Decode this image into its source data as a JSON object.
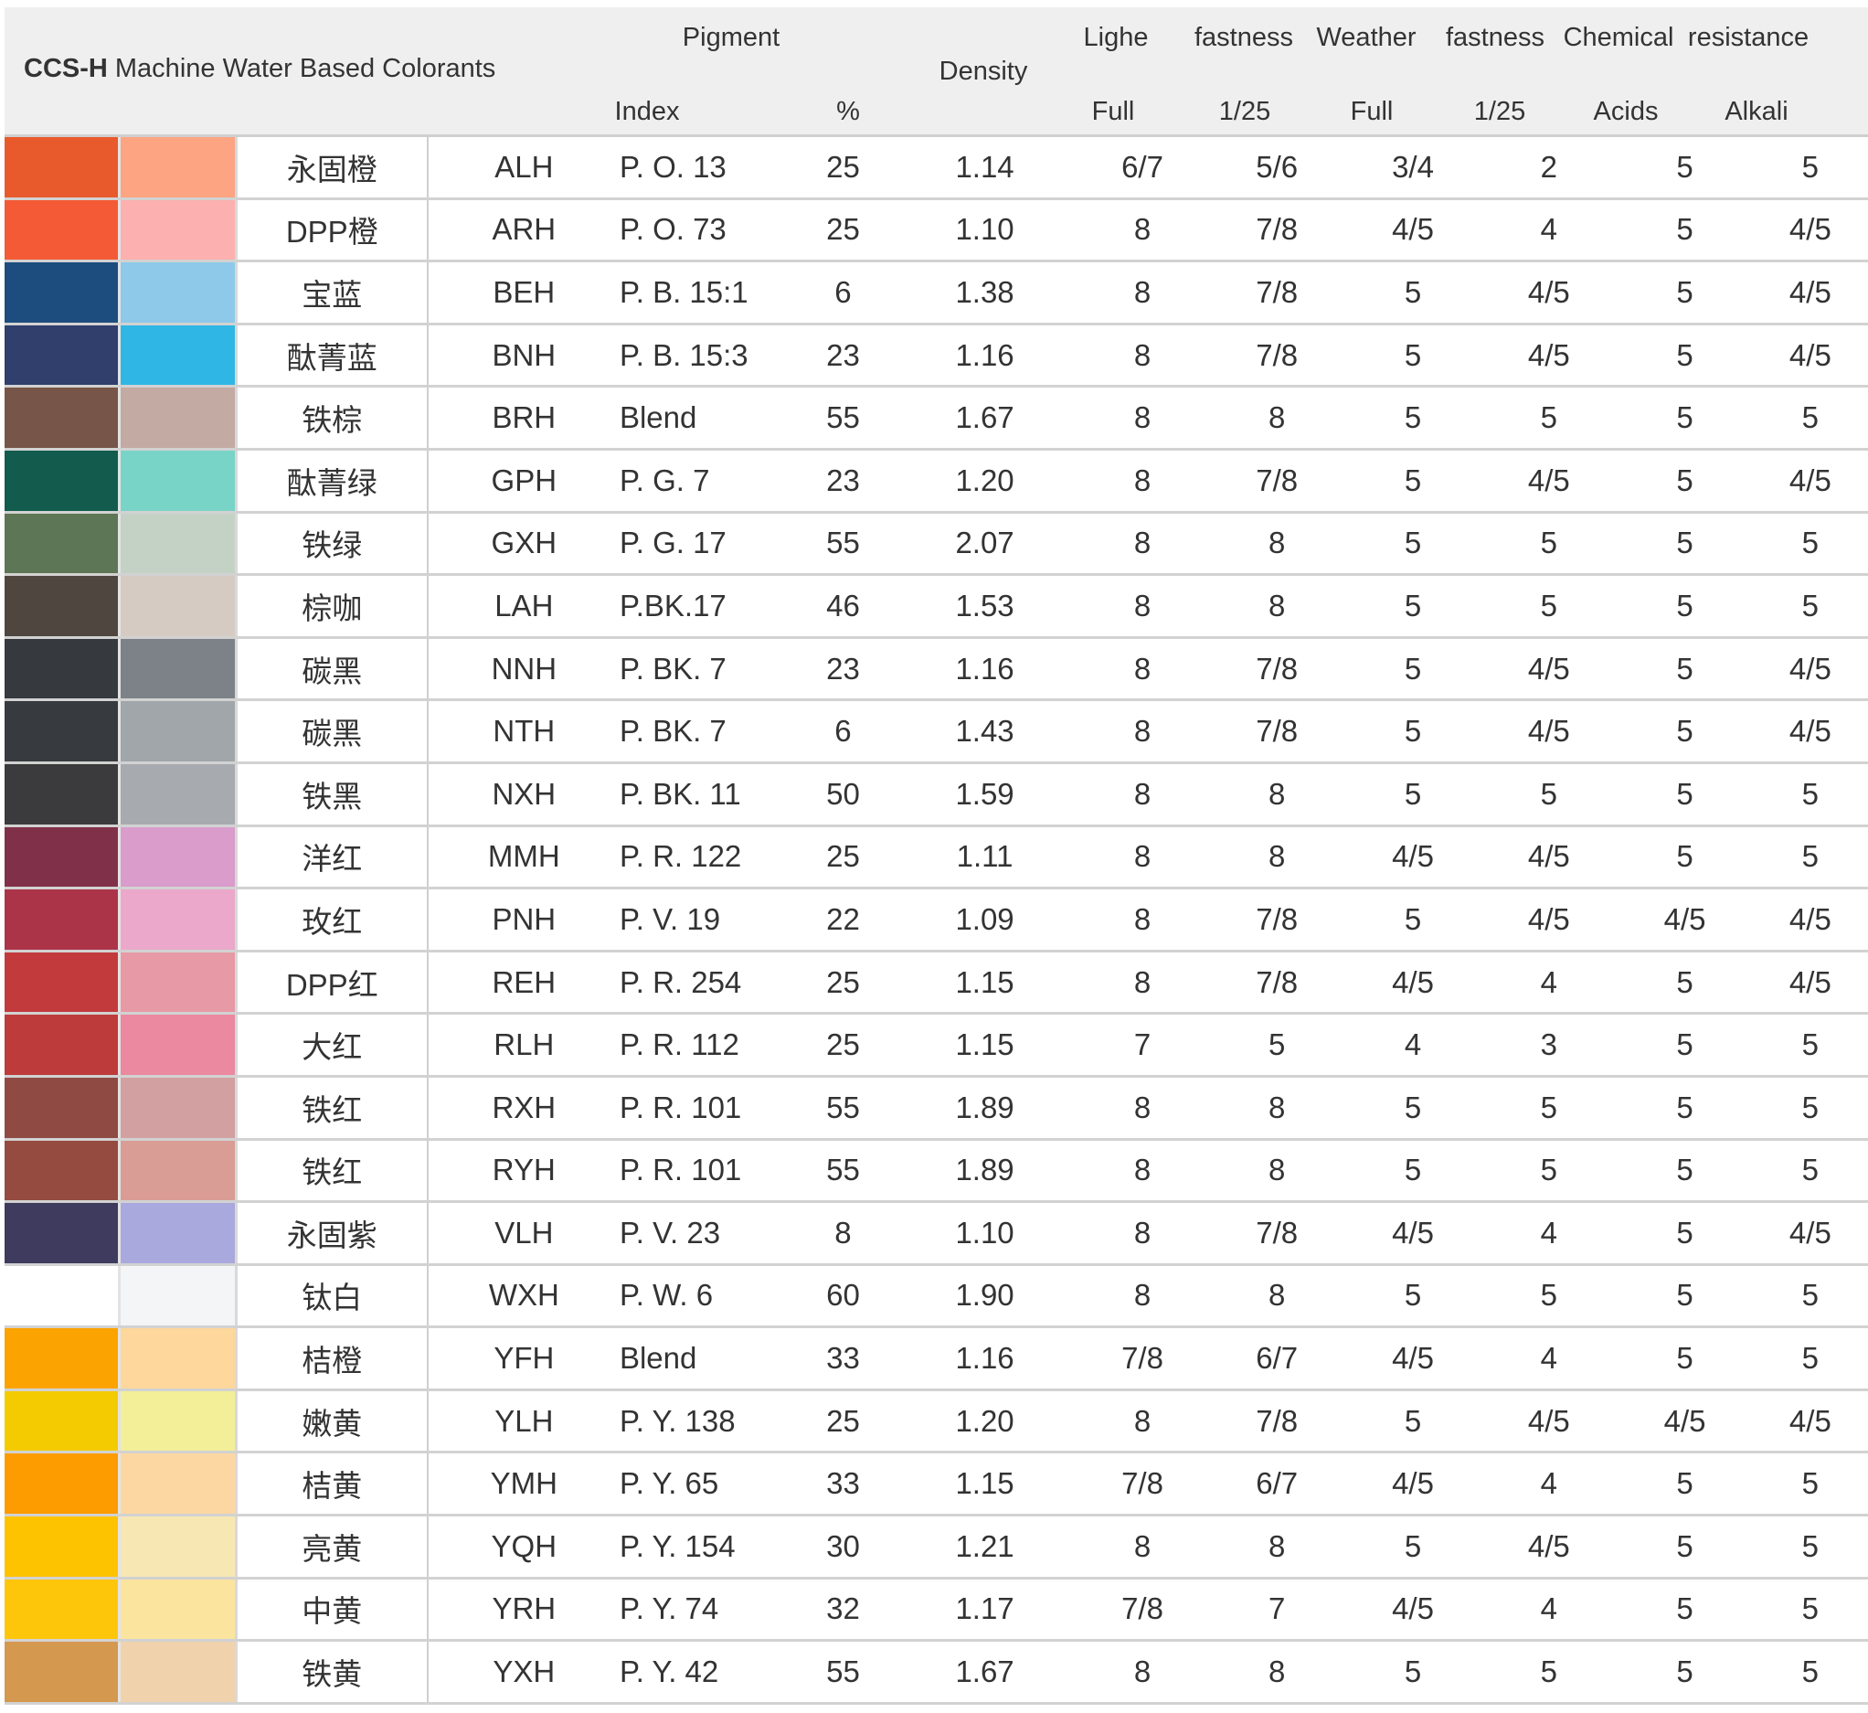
{
  "header": {
    "title_bold": "CCS-H",
    "title_rest": " Machine Water Based Colorants",
    "pigment": "Pigment",
    "index": "Index",
    "percent": "%",
    "density": "Density",
    "lighe": "Lighe",
    "fastness1": "fastness",
    "weather": "Weather",
    "fastness2": "fastness",
    "chemical": "Chemical",
    "resistance": "resistance",
    "full1": "Full",
    "ratio1": "1/25",
    "full2": "Full",
    "ratio2": "1/25",
    "acids": "Acids",
    "alkali": "Alkali"
  },
  "rows": [
    {
      "c1": "#e85a2c",
      "c2": "#fda482",
      "cn": "永固橙",
      "code": "ALH",
      "index": "P. O. 13",
      "pct": "25",
      "density": "1.14",
      "lf": "6/7",
      "lr": "5/6",
      "wf": "3/4",
      "wr": "2",
      "acid": "5",
      "alk": "5"
    },
    {
      "c1": "#f35a35",
      "c2": "#fdb0b0",
      "cn": "DPP橙",
      "code": "ARH",
      "index": "P. O. 73",
      "pct": "25",
      "density": "1.10",
      "lf": "8",
      "lr": "7/8",
      "wf": "4/5",
      "wr": "4",
      "acid": "5",
      "alk": "4/5"
    },
    {
      "c1": "#1c4d7e",
      "c2": "#8ec9e9",
      "cn": "宝蓝",
      "code": "BEH",
      "index": "P. B. 15:1",
      "pct": "6",
      "density": "1.38",
      "lf": "8",
      "lr": "7/8",
      "wf": "5",
      "wr": "4/5",
      "acid": "5",
      "alk": "4/5"
    },
    {
      "c1": "#303f6c",
      "c2": "#2fb6e4",
      "cn": "酞菁蓝",
      "code": "BNH",
      "index": "P. B. 15:3",
      "pct": "23",
      "density": "1.16",
      "lf": "8",
      "lr": "7/8",
      "wf": "5",
      "wr": "4/5",
      "acid": "5",
      "alk": "4/5"
    },
    {
      "c1": "#775549",
      "c2": "#c3aaa3",
      "cn": "铁棕",
      "code": "BRH",
      "index": "Blend",
      "pct": "55",
      "density": "1.67",
      "lf": "8",
      "lr": "8",
      "wf": "5",
      "wr": "5",
      "acid": "5",
      "alk": "5"
    },
    {
      "c1": "#135b4d",
      "c2": "#78d4c6",
      "cn": "酞菁绿",
      "code": "GPH",
      "index": "P. G. 7",
      "pct": "23",
      "density": "1.20",
      "lf": "8",
      "lr": "7/8",
      "wf": "5",
      "wr": "4/5",
      "acid": "5",
      "alk": "4/5"
    },
    {
      "c1": "#5d7655",
      "c2": "#c4d2c5",
      "cn": "铁绿",
      "code": "GXH",
      "index": "P. G. 17",
      "pct": "55",
      "density": "2.07",
      "lf": "8",
      "lr": "8",
      "wf": "5",
      "wr": "5",
      "acid": "5",
      "alk": "5"
    },
    {
      "c1": "#4f4640",
      "c2": "#d5cbc3",
      "cn": "棕咖",
      "code": "LAH",
      "index": "P.BK.17",
      "pct": "46",
      "density": "1.53",
      "lf": "8",
      "lr": "8",
      "wf": "5",
      "wr": "5",
      "acid": "5",
      "alk": "5"
    },
    {
      "c1": "#363a3f",
      "c2": "#7d8288",
      "cn": "碳黑",
      "code": "NNH",
      "index": "P. BK. 7",
      "pct": "23",
      "density": "1.16",
      "lf": "8",
      "lr": "7/8",
      "wf": "5",
      "wr": "4/5",
      "acid": "5",
      "alk": "4/5"
    },
    {
      "c1": "#373a3e",
      "c2": "#a1a6ab",
      "cn": "碳黑",
      "code": "NTH",
      "index": "P. BK. 7",
      "pct": "6",
      "density": "1.43",
      "lf": "8",
      "lr": "7/8",
      "wf": "5",
      "wr": "4/5",
      "acid": "5",
      "alk": "4/5"
    },
    {
      "c1": "#3b3a3d",
      "c2": "#a7abb0",
      "cn": "铁黑",
      "code": "NXH",
      "index": "P. BK. 11",
      "pct": "50",
      "density": "1.59",
      "lf": "8",
      "lr": "8",
      "wf": "5",
      "wr": "5",
      "acid": "5",
      "alk": "5"
    },
    {
      "c1": "#81304a",
      "c2": "#d99ccb",
      "cn": "洋红",
      "code": "MMH",
      "index": "P. R. 122",
      "pct": "25",
      "density": "1.11",
      "lf": "8",
      "lr": "8",
      "wf": "4/5",
      "wr": "4/5",
      "acid": "5",
      "alk": "5"
    },
    {
      "c1": "#ac3449",
      "c2": "#eba8cb",
      "cn": "玫红",
      "code": "PNH",
      "index": "P. V. 19",
      "pct": "22",
      "density": "1.09",
      "lf": "8",
      "lr": "7/8",
      "wf": "5",
      "wr": "4/5",
      "acid": "4/5",
      "alk": "4/5"
    },
    {
      "c1": "#c33a3c",
      "c2": "#e899a6",
      "cn": "DPP红",
      "code": "REH",
      "index": "P. R. 254",
      "pct": "25",
      "density": "1.15",
      "lf": "8",
      "lr": "7/8",
      "wf": "4/5",
      "wr": "4",
      "acid": "5",
      "alk": "4/5"
    },
    {
      "c1": "#bd3b3a",
      "c2": "#ea89a0",
      "cn": "大红",
      "code": "RLH",
      "index": "P. R. 112",
      "pct": "25",
      "density": "1.15",
      "lf": "7",
      "lr": "5",
      "wf": "4",
      "wr": "3",
      "acid": "5",
      "alk": "5"
    },
    {
      "c1": "#8f4a44",
      "c2": "#d2a0a0",
      "cn": "铁红",
      "code": "RXH",
      "index": "P. R. 101",
      "pct": "55",
      "density": "1.89",
      "lf": "8",
      "lr": "8",
      "wf": "5",
      "wr": "5",
      "acid": "5",
      "alk": "5"
    },
    {
      "c1": "#964b41",
      "c2": "#d99d96",
      "cn": "铁红",
      "code": "RYH",
      "index": "P. R. 101",
      "pct": "55",
      "density": "1.89",
      "lf": "8",
      "lr": "8",
      "wf": "5",
      "wr": "5",
      "acid": "5",
      "alk": "5"
    },
    {
      "c1": "#3e3b5e",
      "c2": "#aaa9de",
      "cn": "永固紫",
      "code": "VLH",
      "index": "P. V. 23",
      "pct": "8",
      "density": "1.10",
      "lf": "8",
      "lr": "7/8",
      "wf": "4/5",
      "wr": "4",
      "acid": "5",
      "alk": "4/5"
    },
    {
      "c1": "#ffffff",
      "c2": "#f4f5f7",
      "cn": "钛白",
      "code": "WXH",
      "index": "P. W. 6",
      "pct": "60",
      "density": "1.90",
      "lf": "8",
      "lr": "8",
      "wf": "5",
      "wr": "5",
      "acid": "5",
      "alk": "5"
    },
    {
      "c1": "#fba300",
      "c2": "#fdd79b",
      "cn": "桔橙",
      "code": "YFH",
      "index": "Blend",
      "pct": "33",
      "density": "1.16",
      "lf": "7/8",
      "lr": "6/7",
      "wf": "4/5",
      "wr": "4",
      "acid": "5",
      "alk": "5"
    },
    {
      "c1": "#f3cb00",
      "c2": "#f3ef98",
      "cn": "嫩黄",
      "code": "YLH",
      "index": "P. Y. 138",
      "pct": "25",
      "density": "1.20",
      "lf": "8",
      "lr": "7/8",
      "wf": "5",
      "wr": "4/5",
      "acid": "4/5",
      "alk": "4/5"
    },
    {
      "c1": "#fc9c00",
      "c2": "#fdd7a2",
      "cn": "桔黄",
      "code": "YMH",
      "index": "P. Y. 65",
      "pct": "33",
      "density": "1.15",
      "lf": "7/8",
      "lr": "6/7",
      "wf": "4/5",
      "wr": "4",
      "acid": "5",
      "alk": "5"
    },
    {
      "c1": "#fdc300",
      "c2": "#f7e8b3",
      "cn": "亮黄",
      "code": "YQH",
      "index": "P. Y. 154",
      "pct": "30",
      "density": "1.21",
      "lf": "8",
      "lr": "8",
      "wf": "5",
      "wr": "4/5",
      "acid": "5",
      "alk": "5"
    },
    {
      "c1": "#fec60b",
      "c2": "#fbe49e",
      "cn": "中黄",
      "code": "YRH",
      "index": "P. Y. 74",
      "pct": "32",
      "density": "1.17",
      "lf": "7/8",
      "lr": "7",
      "wf": "4/5",
      "wr": "4",
      "acid": "5",
      "alk": "5"
    },
    {
      "c1": "#d5984f",
      "c2": "#f0d2ad",
      "cn": "铁黄",
      "code": "YXH",
      "index": "P. Y. 42",
      "pct": "55",
      "density": "1.67",
      "lf": "8",
      "lr": "8",
      "wf": "5",
      "wr": "5",
      "acid": "5",
      "alk": "5"
    }
  ]
}
